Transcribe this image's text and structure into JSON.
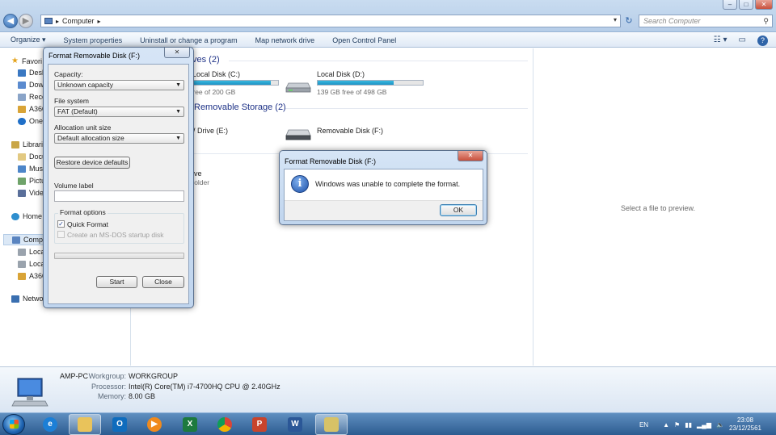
{
  "window": {
    "address": {
      "breadcrumb": "Computer"
    },
    "search_placeholder": "Search Computer",
    "controls": {
      "minimize": "–",
      "maximize": "□",
      "close": "✕"
    }
  },
  "toolbar": {
    "organize": "Organize ▾",
    "system_properties": "System properties",
    "uninstall": "Uninstall or change a program",
    "map_drive": "Map network drive",
    "control_panel": "Open Control Panel"
  },
  "nav": {
    "favorites": "Favori",
    "desktop": "Desk",
    "downloads": "Dow",
    "recent": "Rece",
    "a360": "A360",
    "onedrive": "OneI",
    "libraries": "Librari",
    "documents": "Docu",
    "music": "Mus",
    "pictures": "Pictu",
    "videos": "Vide",
    "homegroup": "Home",
    "computer": "Comp",
    "local1": "Loca",
    "local2": "Loca",
    "a360_2": "A360",
    "network": "Netwo"
  },
  "content": {
    "hard_drives_group": "ves (2)",
    "drive_c": {
      "name": "Local Disk (C:)",
      "free": "free of 200 GB",
      "used_fraction": 0.92
    },
    "drive_d": {
      "name": "Local Disk (D:)",
      "free": "139 GB free of 498 GB",
      "used_fraction": 0.72
    },
    "removable_group": "Removable Storage (2)",
    "dvd_drive": "W Drive (E:)",
    "removable_f": "Removable Disk (F:)",
    "other_name": "rive",
    "other_sub": "Folder"
  },
  "preview": {
    "message": "Select a file to preview."
  },
  "details": {
    "computer_name": "AMP-PC",
    "workgroup_label": "Workgroup:",
    "workgroup": "WORKGROUP",
    "processor_label": "Processor:",
    "processor": "Intel(R) Core(TM) i7-4700HQ CPU @ 2.40GHz",
    "memory_label": "Memory:",
    "memory": "8.00 GB"
  },
  "format_dialog": {
    "title": "Format Removable Disk (F:)",
    "close": "✕",
    "capacity_label": "Capacity:",
    "capacity_value": "Unknown capacity",
    "filesystem_label": "File system",
    "filesystem_value": "FAT (Default)",
    "alloc_label": "Allocation unit size",
    "alloc_value": "Default allocation size",
    "restore_button": "Restore device defaults",
    "volume_label": "Volume label",
    "volume_value": "",
    "options_label": "Format options",
    "quick_format": "Quick Format",
    "msdos": "Create an MS-DOS startup disk",
    "start": "Start",
    "close_button": "Close"
  },
  "error_dialog": {
    "title": "Format Removable Disk (F:)",
    "close": "✕",
    "message": "Windows was unable to complete the format.",
    "ok": "OK"
  },
  "taskbar": {
    "language": "EN",
    "time": "23:08",
    "date": "23/12/2561"
  },
  "colors": {
    "drive_bar": "#1d93c6",
    "group_header": "#1e3287",
    "taskbar": "#2c5b90"
  }
}
